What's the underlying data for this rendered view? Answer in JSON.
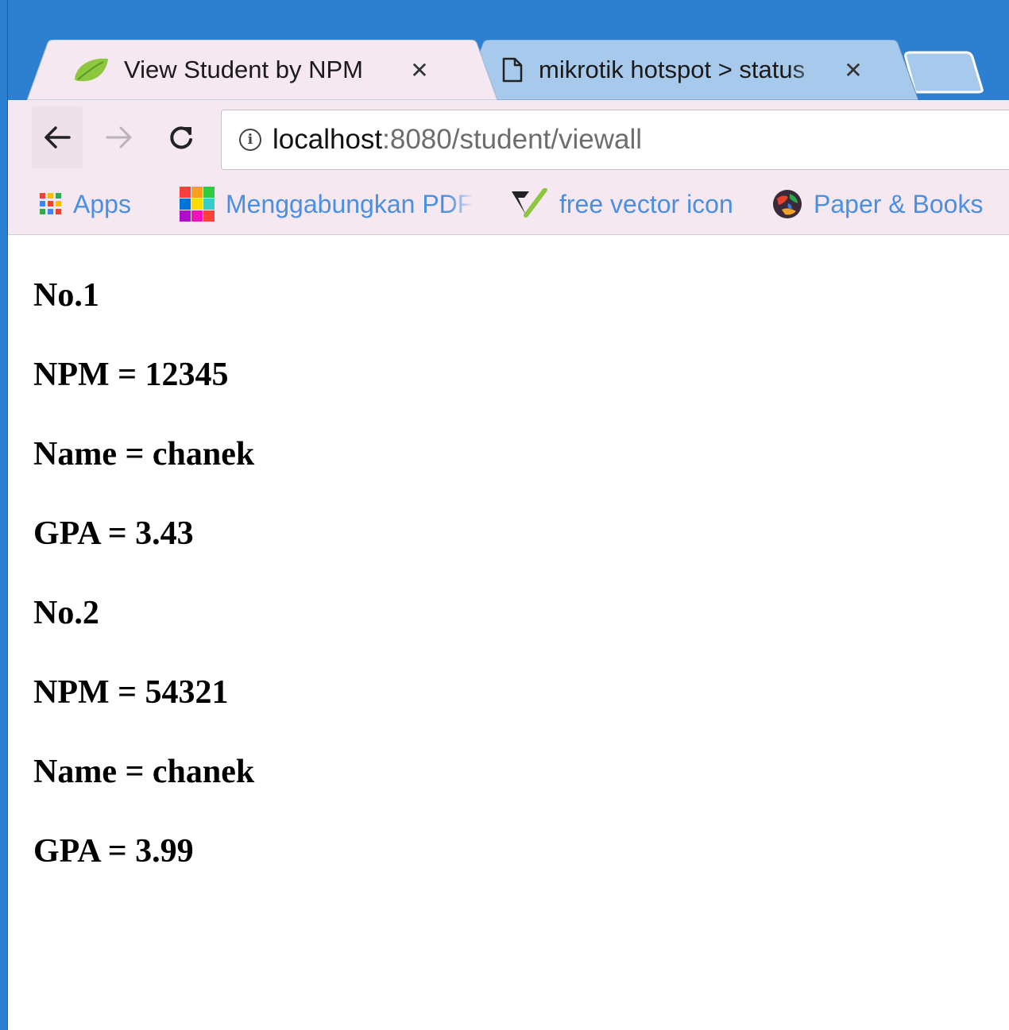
{
  "browser": {
    "tabs": [
      {
        "title": "View Student by NPM",
        "icon": "spring-leaf-icon",
        "active": true
      },
      {
        "title": "mikrotik hotspot > status",
        "icon": "page-icon",
        "active": false
      }
    ],
    "close_glyph": "✕",
    "url": {
      "host": "localhost",
      "rest": ":8080/student/viewall"
    },
    "bookmarks": [
      {
        "label": "Apps",
        "icon": "apps-grid-icon"
      },
      {
        "label": "Menggabungkan PDF",
        "icon": "colorful-squares-icon"
      },
      {
        "label": "free vector icon",
        "icon": "vector-check-icon"
      },
      {
        "label": "Paper & Books",
        "icon": "globe-icon"
      }
    ]
  },
  "students": [
    {
      "no": "No.1",
      "npm": "NPM = 12345",
      "name": "Name = chanek",
      "gpa": "GPA = 3.43"
    },
    {
      "no": "No.2",
      "npm": "NPM = 54321",
      "name": "Name = chanek",
      "gpa": "GPA = 3.99"
    }
  ],
  "colors": {
    "title_bar": "#2d7fcf",
    "toolbar": "#f6e8f0",
    "bookmark_text": "#4a90e2"
  }
}
